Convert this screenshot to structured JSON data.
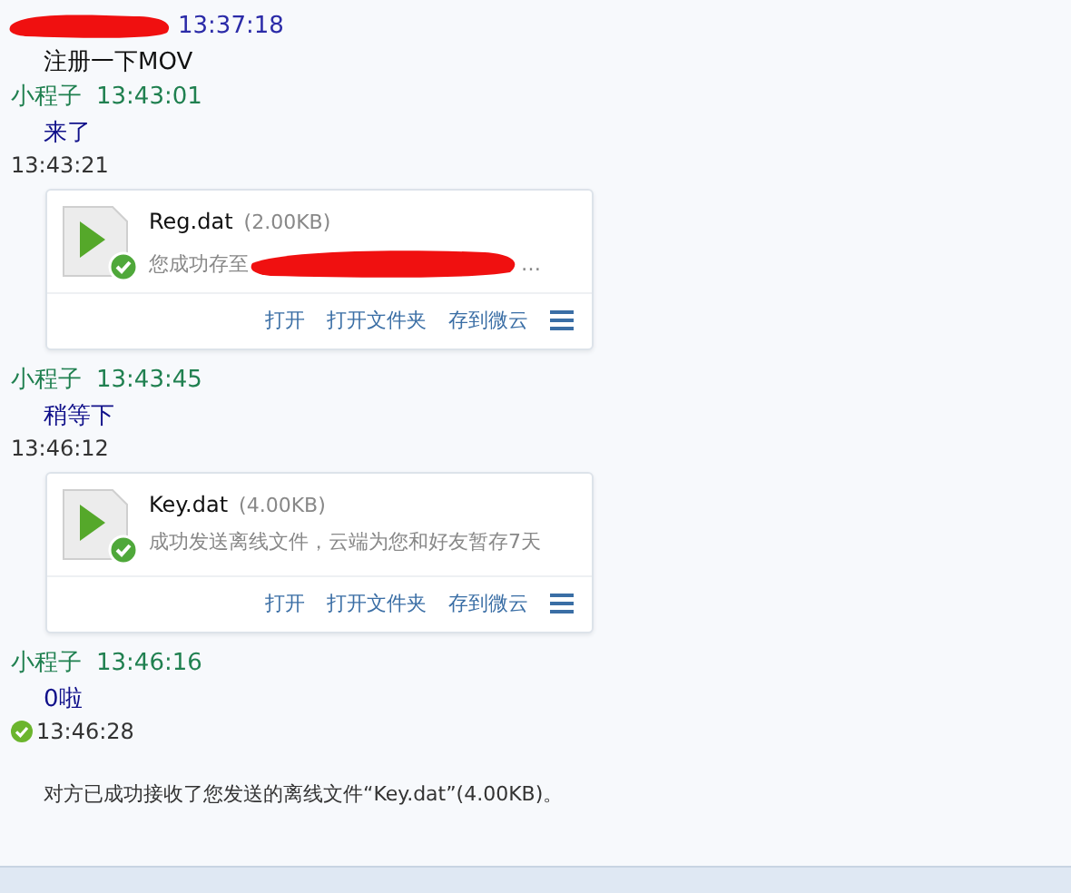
{
  "messages": [
    {
      "kind": "self-header",
      "redacted": true,
      "time": "13:37:18"
    },
    {
      "kind": "text",
      "outgoing": true,
      "text": "注册一下MOV"
    },
    {
      "kind": "peer-header",
      "sender": "小程子",
      "time": "13:43:01"
    },
    {
      "kind": "text",
      "outgoing": false,
      "text": "来了"
    },
    {
      "kind": "time",
      "delivered": false,
      "time": "13:43:21"
    },
    {
      "kind": "file",
      "name": "Reg.dat",
      "size": "(2.00KB)",
      "status": "您成功存至",
      "redacted": true,
      "status_tail": "…",
      "actions": [
        "打开",
        "打开文件夹",
        "存到微云"
      ]
    },
    {
      "kind": "peer-header",
      "sender": "小程子",
      "time": "13:43:45"
    },
    {
      "kind": "text",
      "outgoing": false,
      "text": "稍等下"
    },
    {
      "kind": "time",
      "delivered": false,
      "time": "13:46:12"
    },
    {
      "kind": "file",
      "name": "Key.dat",
      "size": "(4.00KB)",
      "status": "成功发送离线文件，云端为您和好友暂存7天",
      "redacted": false,
      "actions": [
        "打开",
        "打开文件夹",
        "存到微云"
      ]
    },
    {
      "kind": "peer-header",
      "sender": "小程子",
      "time": "13:46:16"
    },
    {
      "kind": "text",
      "outgoing": false,
      "text": "0啦"
    },
    {
      "kind": "time",
      "delivered": true,
      "time": "13:46:28"
    },
    {
      "kind": "notice",
      "text": "对方已成功接收了您发送的离线文件“Key.dat”(4.00KB)。"
    }
  ]
}
